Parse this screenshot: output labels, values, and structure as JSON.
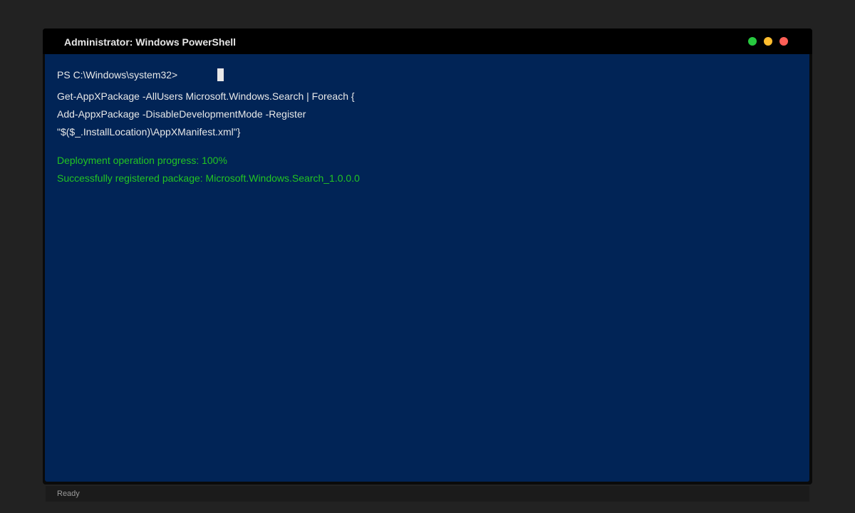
{
  "window": {
    "title": "Administrator: Windows PowerShell",
    "controls": [
      {
        "name": "maximize",
        "color": "#27c93f"
      },
      {
        "name": "minimize",
        "color": "#ffbd2e"
      },
      {
        "name": "close",
        "color": "#ff5f57"
      }
    ]
  },
  "console": {
    "background": "#012456",
    "text_color": "#e8e8e8",
    "success_color": "#22c522",
    "prompt": "PS C:\\Windows\\system32>",
    "command_lines": [
      "Get-AppXPackage -AllUsers Microsoft.Windows.Search | Foreach {",
      "Add-AppxPackage -DisableDevelopmentMode -Register",
      "\"$($_.InstallLocation)\\AppXManifest.xml\"}"
    ],
    "output_lines": [
      "Deployment operation progress: 100%",
      "Successfully registered package: Microsoft.Windows.Search_1.0.0.0"
    ]
  },
  "status_bar": {
    "text": "Ready"
  }
}
